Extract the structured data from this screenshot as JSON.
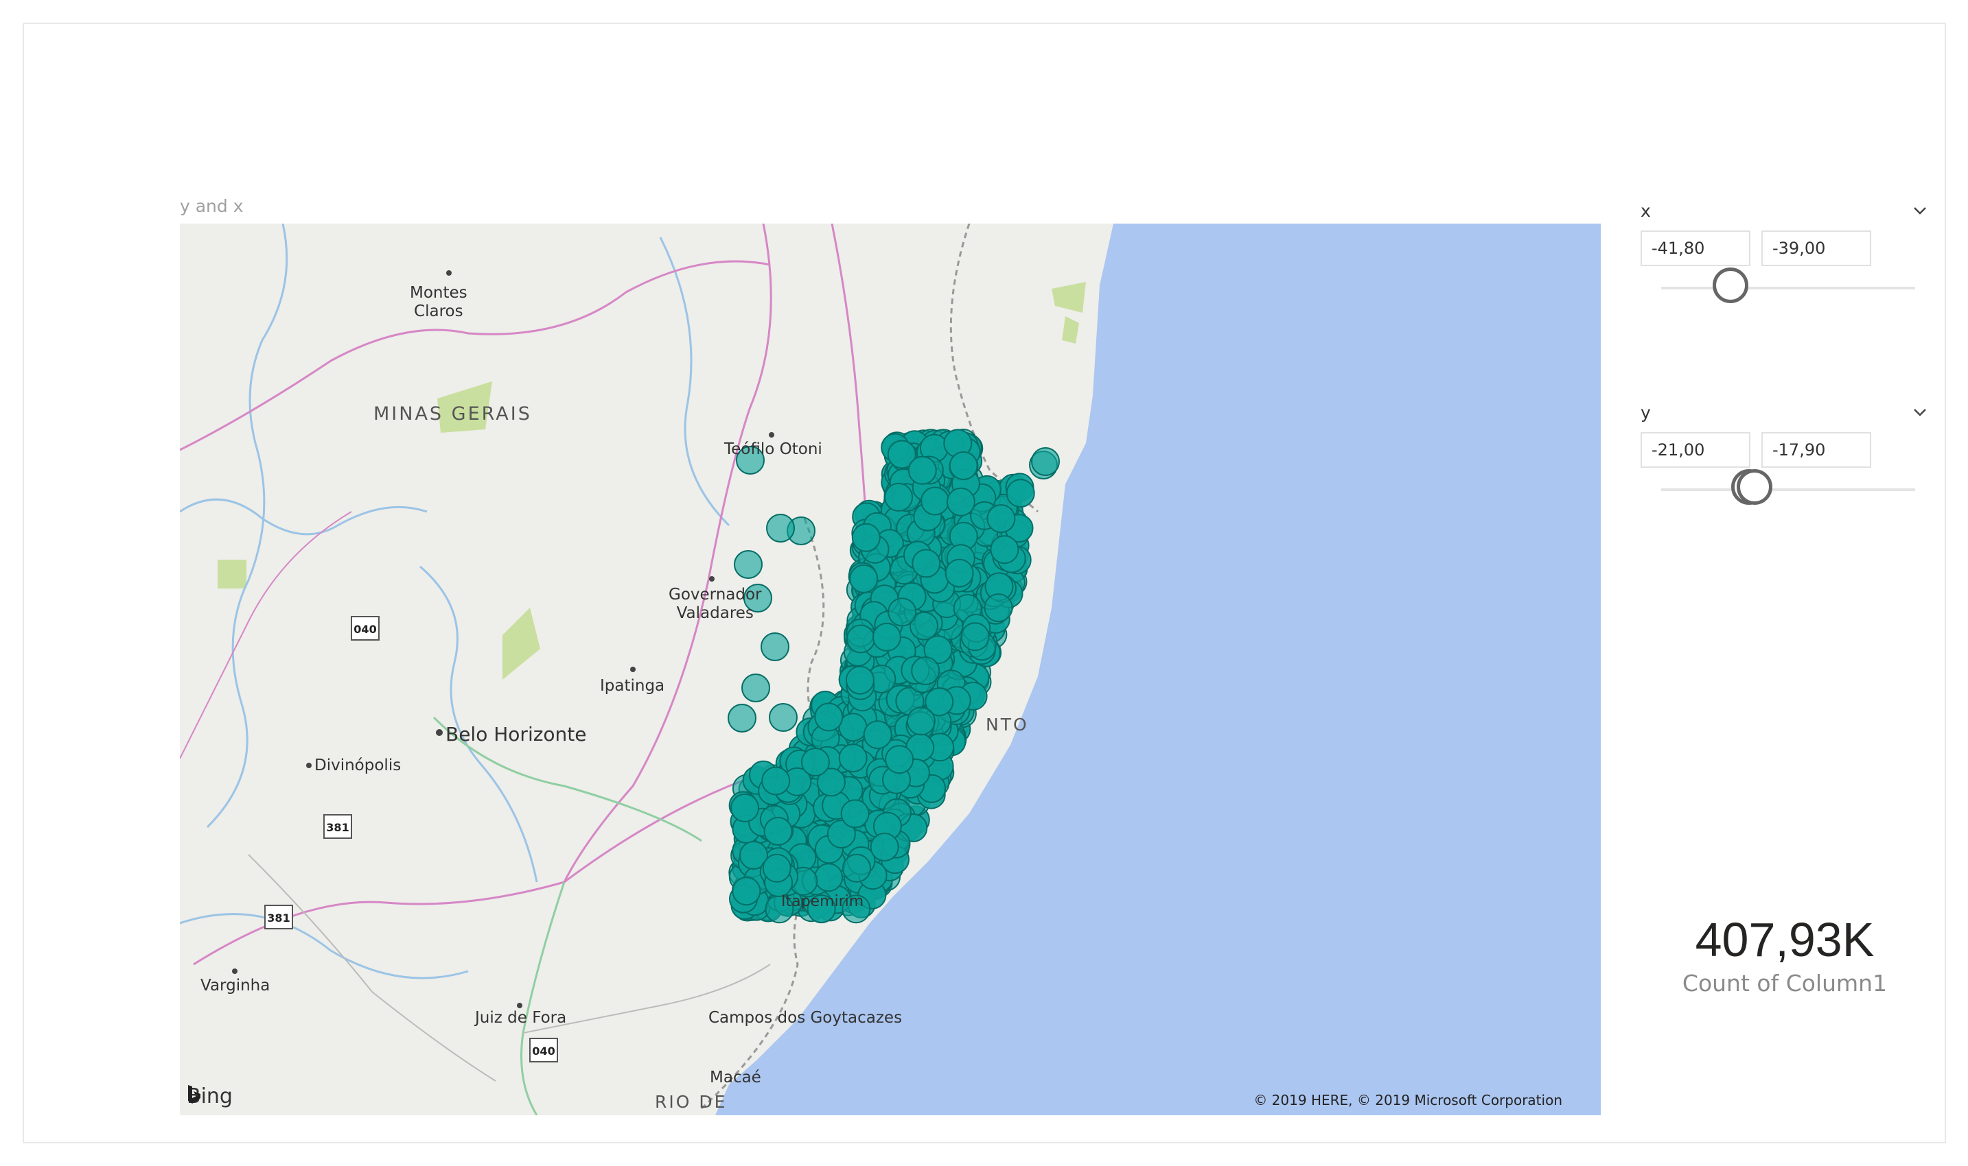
{
  "visual": {
    "title": "y and x"
  },
  "map": {
    "labels": [
      {
        "id": "montes-claros",
        "text": "Montes\nClaros"
      },
      {
        "id": "minas-gerais",
        "text": "MINAS GERAIS"
      },
      {
        "id": "teofilo-otoni",
        "text": "Teófilo Otoni"
      },
      {
        "id": "governador-valadares",
        "text": "Governador\nValadares"
      },
      {
        "id": "ipatinga",
        "text": "Ipatinga"
      },
      {
        "id": "belo-horizonte",
        "text": "Belo Horizonte"
      },
      {
        "id": "divinopolis",
        "text": "Divinópolis"
      },
      {
        "id": "varginha",
        "text": "Varginha"
      },
      {
        "id": "juiz-de-fora",
        "text": "Juiz de Fora"
      },
      {
        "id": "campos-dos-goytacazes",
        "text": "Campos dos Goytacazes"
      },
      {
        "id": "macae",
        "text": "Macaé"
      },
      {
        "id": "rio-de",
        "text": "RIO DE"
      },
      {
        "id": "espirito-santo-partial",
        "text": "NTO"
      },
      {
        "id": "itapemirim",
        "text": "Itapemirim"
      }
    ],
    "shields": [
      "040",
      "381",
      "381",
      "040"
    ],
    "attribution": "Bing",
    "copyright": "© 2019 HERE, © 2019 Microsoft Corporation",
    "colors": {
      "water": "#abc6f0",
      "land": "#eeeeea",
      "bubble": "#0ba39a",
      "bubble_edge": "#046e66",
      "road": "#d687c6",
      "border": "#999999",
      "river": "#9bc4e6",
      "park": "#c9df9f"
    }
  },
  "slicers": [
    {
      "id": "x",
      "title": "x",
      "min": "-41,80",
      "max": "-39,00"
    },
    {
      "id": "y",
      "title": "y",
      "min": "-21,00",
      "max": "-17,90"
    }
  ],
  "card": {
    "value": "407,93K",
    "label": "Count of Column1"
  }
}
